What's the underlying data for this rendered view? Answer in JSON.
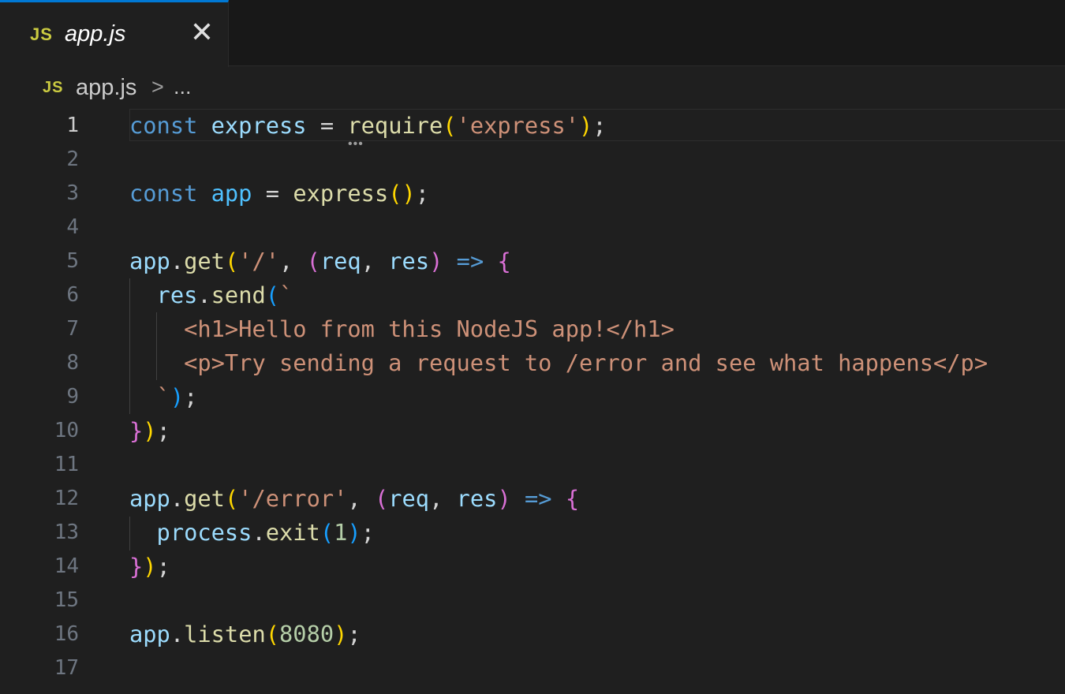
{
  "tab": {
    "icon_label": "JS",
    "file_name": "app.js",
    "close_glyph": "✕"
  },
  "breadcrumb": {
    "icon_label": "JS",
    "file_name": "app.js",
    "separator": ">",
    "more": "..."
  },
  "editor": {
    "active_line": 1,
    "lines": [
      {
        "n": "1"
      },
      {
        "n": "2"
      },
      {
        "n": "3"
      },
      {
        "n": "4"
      },
      {
        "n": "5"
      },
      {
        "n": "6"
      },
      {
        "n": "7"
      },
      {
        "n": "8"
      },
      {
        "n": "9"
      },
      {
        "n": "10"
      },
      {
        "n": "11"
      },
      {
        "n": "12"
      },
      {
        "n": "13"
      },
      {
        "n": "14"
      },
      {
        "n": "15"
      },
      {
        "n": "16"
      },
      {
        "n": "17"
      }
    ],
    "tokens": {
      "const": "const",
      "express": "express",
      "eq": "=",
      "require": "require",
      "lp": "(",
      "rp": ")",
      "str_express": "'express'",
      "semi": ";",
      "app": "app",
      "dot": ".",
      "get": "get",
      "str_root": "'/'",
      "comma": ",",
      "req": "req",
      "res": "res",
      "arrow": "=>",
      "lb": "{",
      "rb": "}",
      "send": "send",
      "backtick": "`",
      "html_line1": "<h1>Hello from this NodeJS app!</h1>",
      "html_line2": "<p>Try sending a request to /error and see what happens</p>",
      "str_error": "'/error'",
      "process": "process",
      "exit": "exit",
      "num_1": "1",
      "listen": "listen",
      "num_8080": "8080"
    }
  }
}
